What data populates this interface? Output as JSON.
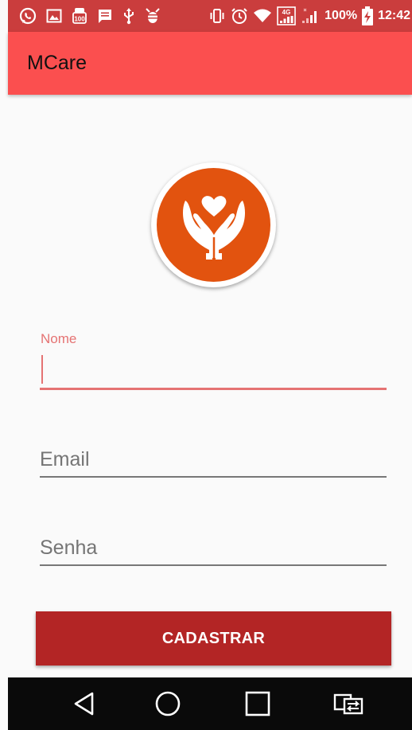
{
  "status_bar": {
    "background": "#ca3d3d",
    "left_icons": [
      "whatsapp-icon",
      "image-icon",
      "hundred-badge-icon",
      "message-icon",
      "usb-icon",
      "debug-icon"
    ],
    "right_icons": [
      "vibrate-icon",
      "alarm-icon",
      "wifi-icon",
      "signal-4g-icon",
      "signal-weak-icon",
      "battery-charging-icon"
    ],
    "network_label": "4G",
    "battery": "100%",
    "time": "12:42"
  },
  "app_bar": {
    "title": "MCare",
    "background": "#fb4f4f"
  },
  "logo": {
    "icon": "heart-hands-icon",
    "color": "#e2530f"
  },
  "form": {
    "name": {
      "label": "Nome",
      "value": "",
      "focused": true
    },
    "email": {
      "placeholder": "Email",
      "value": ""
    },
    "password": {
      "placeholder": "Senha",
      "value": ""
    },
    "submit_label": "CADASTRAR",
    "submit_color": "#b32525",
    "accent": "#e57373"
  },
  "nav_bar": {
    "buttons": [
      "back-icon",
      "home-icon",
      "recents-icon",
      "screen-switch-icon"
    ]
  }
}
